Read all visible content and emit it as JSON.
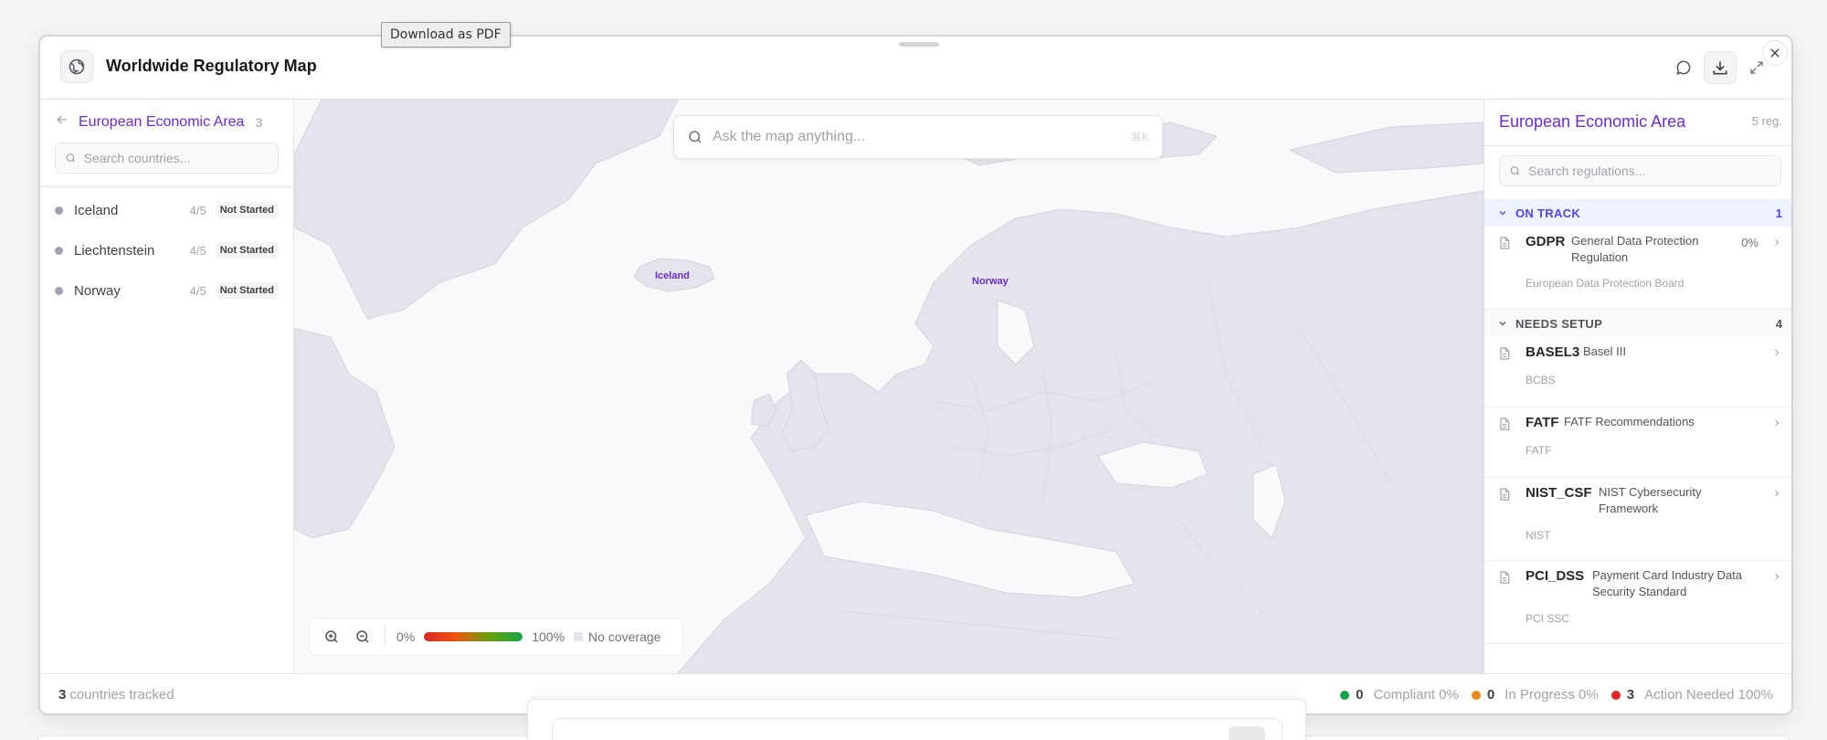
{
  "tooltip": "Download as PDF",
  "header": {
    "title": "Worldwide Regulatory Map",
    "logo_icon": "globe-icon",
    "actions": [
      "chat-icon",
      "download-icon",
      "expand-icon"
    ],
    "close_icon": "close-icon"
  },
  "left_panel": {
    "region": "European Economic Area",
    "count": "3",
    "search_placeholder": "Search countries...",
    "countries": [
      {
        "name": "Iceland",
        "score": "4/5",
        "status": "Not Started"
      },
      {
        "name": "Liechtenstein",
        "score": "4/5",
        "status": "Not Started"
      },
      {
        "name": "Norway",
        "score": "4/5",
        "status": "Not Started"
      }
    ]
  },
  "map": {
    "ask_placeholder": "Ask the map anything...",
    "shortcut": "⌘K",
    "labels": {
      "iceland": "Iceland",
      "norway": "Norway"
    },
    "legend": {
      "min": "0%",
      "max": "100%",
      "no_coverage": "No coverage"
    }
  },
  "right_panel": {
    "title": "European Economic Area",
    "count": "5 reg.",
    "search_placeholder": "Search regulations...",
    "groups": [
      {
        "title": "ON TRACK",
        "count": "1",
        "color": "#4f46e5",
        "items": [
          {
            "code": "GDPR",
            "name": "General Data Protection Regulation",
            "body": "European Data Protection Board",
            "pct": "0%"
          }
        ]
      },
      {
        "title": "NEEDS SETUP",
        "count": "4",
        "color": "#52525b",
        "items": [
          {
            "code": "BASEL3",
            "name": "Basel III",
            "body": "BCBS"
          },
          {
            "code": "FATF",
            "name": "FATF Recommendations",
            "body": "FATF"
          },
          {
            "code": "NIST_CSF",
            "name": "NIST Cybersecurity Framework",
            "body": "NIST"
          },
          {
            "code": "PCI_DSS",
            "name": "Payment Card Industry Data Security Standard",
            "body": "PCI SSC"
          }
        ]
      }
    ]
  },
  "footer": {
    "tracked_count": "3",
    "tracked_label": "countries tracked",
    "stats": [
      {
        "count": "0",
        "label": "Compliant 0%",
        "color": "#16a34a"
      },
      {
        "count": "0",
        "label": "In Progress 0%",
        "color": "#ea8a1a"
      },
      {
        "count": "3",
        "label": "Action Needed 100%",
        "color": "#dc2626"
      }
    ]
  }
}
